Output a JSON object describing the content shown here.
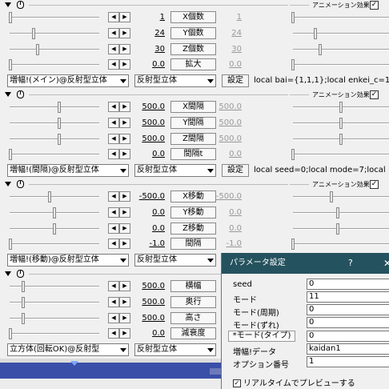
{
  "effect_label": "アニメーション効果",
  "effect_check": "✓",
  "arrow_left": "◀",
  "arrow_right": "▶",
  "set_button": "設定",
  "sections": [
    {
      "rows": [
        {
          "v1": "1",
          "label": "X個数",
          "v2": "1"
        },
        {
          "v1": "24",
          "label": "Y個数",
          "v2": "24"
        },
        {
          "v1": "30",
          "label": "Z個数",
          "v2": "30"
        },
        {
          "v1": "0.0",
          "label": "拡大",
          "v2": "0.0"
        }
      ],
      "combo1": "増幅!(メイン)@反射型立体",
      "combo2": "反射型立体",
      "script": "local bai={1,1,1};local enkei_c=1;l"
    },
    {
      "rows": [
        {
          "v1": "500.0",
          "label": "X間隔",
          "v2": "500.0"
        },
        {
          "v1": "500.0",
          "label": "Y間隔",
          "v2": "500.0"
        },
        {
          "v1": "500.0",
          "label": "Z間隔",
          "v2": "500.0"
        },
        {
          "v1": "0.0",
          "label": "間隔t",
          "v2": "0.0"
        }
      ],
      "combo1": "増幅!(間隔)@反射型立体",
      "combo2": "反射型立体",
      "script": "local seed=0;local mode=7;local"
    },
    {
      "rows": [
        {
          "v1": "-500.0",
          "label": "X移動",
          "v2": "-500.0"
        },
        {
          "v1": "0.0",
          "label": "Y移動",
          "v2": "0.0"
        },
        {
          "v1": "0.0",
          "label": "Z移動",
          "v2": "0.0"
        },
        {
          "v1": "-1.0",
          "label": "間隔",
          "v2": "-1.0"
        }
      ],
      "combo1": "増幅!(移動)@反射型立体",
      "combo2": "反射型立体"
    },
    {
      "rows": [
        {
          "v1": "500.0",
          "label": "横幅"
        },
        {
          "v1": "500.0",
          "label": "奥行"
        },
        {
          "v1": "500.0",
          "label": "高さ"
        },
        {
          "v1": "0.0",
          "label": "減衰度"
        }
      ],
      "combo1": "立方体(回転OK)@反射型",
      "combo2": "反射型立体"
    }
  ],
  "dialog": {
    "title": "パラメータ設定",
    "help": "?",
    "close": "✕",
    "params": [
      {
        "key": "seed",
        "value": "0"
      },
      {
        "key": "モード",
        "value": "11"
      },
      {
        "key": "モード(周期)",
        "value": "0"
      },
      {
        "key": "モード(ずれ)",
        "value": "0"
      },
      {
        "key": "*モード(タイプ)",
        "value": "0"
      },
      {
        "key": "増幅!データ",
        "value": "kaidan1"
      },
      {
        "key": "オプション番号",
        "value": "1"
      }
    ],
    "realtime_label": "リアルタイムでプレビューする",
    "realtime_check": "✓"
  }
}
